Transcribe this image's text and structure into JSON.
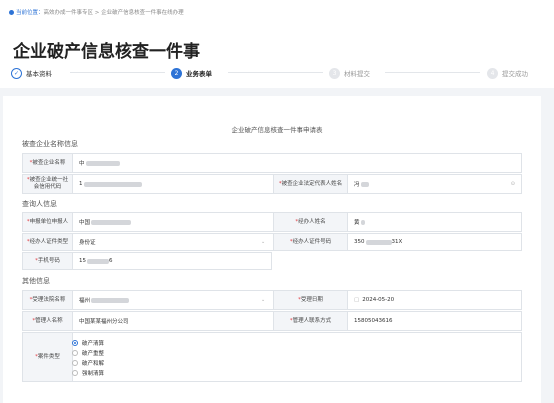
{
  "breadcrumb": {
    "prefix": "当前位置：",
    "home": "高效办成一件事专区",
    "sep": ">",
    "current": "企业破产信息核查一件事在线办理"
  },
  "page_title": "企业破产信息核查一件事",
  "steps": [
    {
      "num": "✓",
      "label": "基本资料",
      "state": "done"
    },
    {
      "num": "2",
      "label": "业务表单",
      "state": "active"
    },
    {
      "num": "3",
      "label": "材料提交",
      "state": "todo"
    },
    {
      "num": "4",
      "label": "提交成功",
      "state": "todo"
    }
  ],
  "form_title": "企业破产信息核查一件事申请表",
  "sections": {
    "checked_enterprise": "被查企业名称信息",
    "query_person": "查询人信息",
    "other": "其他信息"
  },
  "fields": {
    "enterprise_name": {
      "label": "被查企业名称",
      "value": "中"
    },
    "credit_code": {
      "label": "被查企业统一社会信用代码",
      "value": "1"
    },
    "legal_rep": {
      "label": "被查企业法定代表人姓名",
      "value": "冯"
    },
    "applicant_org": {
      "label": "申报单位申报人",
      "value": "中国"
    },
    "handler_name": {
      "label": "经办人姓名",
      "value": "黄"
    },
    "id_type": {
      "label": "经办人证件类型",
      "value": "身份证"
    },
    "id_number": {
      "label": "经办人证件号码",
      "value": "350",
      "suffix": "31X"
    },
    "phone": {
      "label": "手机号码",
      "value": "15",
      "suffix": "6"
    },
    "court": {
      "label": "受理法院名称",
      "value": "福州"
    },
    "accept_date": {
      "label": "受理日期",
      "value": "2024-05-20"
    },
    "admin_name": {
      "label": "管理人名称",
      "value": "中国某某福州分公司"
    },
    "admin_contact": {
      "label": "管理人联系方式",
      "value": "15805043616"
    },
    "case_type": {
      "label": "案件类型",
      "options": [
        "破产清算",
        "破产重整",
        "破产和解",
        "强制清算"
      ],
      "selected": "破产清算"
    }
  },
  "required_mark": "*",
  "colors": {
    "accent": "#2d73d6",
    "required": "#e0393e",
    "label_bg": "#f3f5f8",
    "border": "#dfe3e8"
  }
}
